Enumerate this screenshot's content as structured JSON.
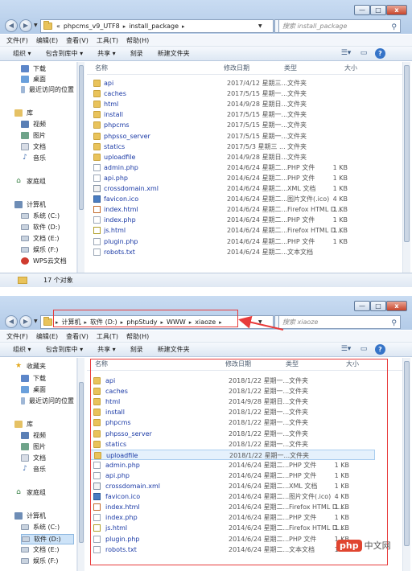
{
  "window_buttons": {
    "minimize": "—",
    "maximize": "□",
    "close": "x"
  },
  "icons": {
    "back": "back-icon",
    "forward": "forward-icon",
    "refresh": "refresh-icon",
    "search": "search-icon",
    "help": "help-icon"
  },
  "colors": {
    "folder": "#e9c35b",
    "selection": "#cde3f8",
    "link_text": "#1b3aa6",
    "annotation_red": "#e83b3b",
    "watermark_red": "#e04530"
  },
  "menu": [
    "文件(F)",
    "编辑(E)",
    "查看(V)",
    "工具(T)",
    "帮助(H)"
  ],
  "toolbar": {
    "organize": "组织 ▾",
    "include": "包含到库中 ▾",
    "share": "共享 ▾",
    "burn": "刻录",
    "new_folder": "新建文件夹"
  },
  "columns": {
    "name": "名称",
    "date": "修改日期",
    "type": "类型",
    "size": "大小"
  },
  "window1": {
    "breadcrumb": [
      "«",
      "phpcms_v9_UTF8",
      "install_package"
    ],
    "search_placeholder": "搜索 install_package",
    "nav": [
      {
        "label": "下载",
        "icon": "dl"
      },
      {
        "label": "桌面",
        "icon": "desk"
      },
      {
        "label": "最近访问的位置",
        "icon": "recent"
      },
      {
        "label": "库",
        "icon": "lib"
      },
      {
        "label": "视频",
        "icon": "vid"
      },
      {
        "label": "图片",
        "icon": "pic"
      },
      {
        "label": "文档",
        "icon": "doc"
      },
      {
        "label": "音乐",
        "icon": "music"
      },
      {
        "label": "家庭组",
        "icon": "home"
      },
      {
        "label": "计算机",
        "icon": "pc"
      },
      {
        "label": "系统 (C:)",
        "icon": "drv"
      },
      {
        "label": "软件 (D:)",
        "icon": "drv"
      },
      {
        "label": "文档 (E:)",
        "icon": "drv"
      },
      {
        "label": "娱乐 (F:)",
        "icon": "drv"
      },
      {
        "label": "WPS云文档",
        "icon": "wps"
      }
    ],
    "files": [
      {
        "name": "api",
        "date": "2017/4/12 星期三...",
        "type": "文件夹",
        "size": "",
        "icon": "folder"
      },
      {
        "name": "caches",
        "date": "2017/5/15 星期一...",
        "type": "文件夹",
        "size": "",
        "icon": "folder"
      },
      {
        "name": "html",
        "date": "2014/9/28 星期日...",
        "type": "文件夹",
        "size": "",
        "icon": "folder"
      },
      {
        "name": "install",
        "date": "2017/5/15 星期一...",
        "type": "文件夹",
        "size": "",
        "icon": "folder"
      },
      {
        "name": "phpcms",
        "date": "2017/5/15 星期一...",
        "type": "文件夹",
        "size": "",
        "icon": "folder"
      },
      {
        "name": "phpsso_server",
        "date": "2017/5/15 星期一...",
        "type": "文件夹",
        "size": "",
        "icon": "folder"
      },
      {
        "name": "statics",
        "date": "2017/5/3 星期三 ...",
        "type": "文件夹",
        "size": "",
        "icon": "folder"
      },
      {
        "name": "uploadfile",
        "date": "2014/9/28 星期日...",
        "type": "文件夹",
        "size": "",
        "icon": "folder"
      },
      {
        "name": "admin.php",
        "date": "2014/6/24 星期二...",
        "type": "PHP 文件",
        "size": "1 KB",
        "icon": "php"
      },
      {
        "name": "api.php",
        "date": "2014/6/24 星期二...",
        "type": "PHP 文件",
        "size": "1 KB",
        "icon": "php"
      },
      {
        "name": "crossdomain.xml",
        "date": "2014/6/24 星期二...",
        "type": "XML 文档",
        "size": "1 KB",
        "icon": "xml"
      },
      {
        "name": "favicon.ico",
        "date": "2014/6/24 星期二...",
        "type": "图片文件(.ico)",
        "size": "4 KB",
        "icon": "ico"
      },
      {
        "name": "index.html",
        "date": "2014/6/24 星期二...",
        "type": "Firefox HTML D...",
        "size": "1 KB",
        "icon": "htm"
      },
      {
        "name": "index.php",
        "date": "2014/6/24 星期二...",
        "type": "PHP 文件",
        "size": "1 KB",
        "icon": "php"
      },
      {
        "name": "js.html",
        "date": "2014/6/24 星期二...",
        "type": "Firefox HTML D...",
        "size": "1 KB",
        "icon": "js"
      },
      {
        "name": "plugin.php",
        "date": "2014/6/24 星期二...",
        "type": "PHP 文件",
        "size": "1 KB",
        "icon": "php"
      },
      {
        "name": "robots.txt",
        "date": "2014/6/24 星期二...",
        "type": "文本文档",
        "size": "",
        "icon": "txt"
      }
    ],
    "status": "17 个对象"
  },
  "window2": {
    "breadcrumb": [
      "计算机",
      "软件 (D:)",
      "phpStudy",
      "WWW",
      "xiaoze"
    ],
    "search_placeholder": "搜索 xiaoze",
    "nav": [
      {
        "label": "收藏夹",
        "icon": "star"
      },
      {
        "label": "下载",
        "icon": "dl"
      },
      {
        "label": "桌面",
        "icon": "desk"
      },
      {
        "label": "最近访问的位置",
        "icon": "recent"
      },
      {
        "label": "库",
        "icon": "lib"
      },
      {
        "label": "视频",
        "icon": "vid"
      },
      {
        "label": "图片",
        "icon": "pic"
      },
      {
        "label": "文档",
        "icon": "doc"
      },
      {
        "label": "音乐",
        "icon": "music"
      },
      {
        "label": "家庭组",
        "icon": "home"
      },
      {
        "label": "计算机",
        "icon": "pc"
      },
      {
        "label": "系统 (C:)",
        "icon": "drv"
      },
      {
        "label": "软件 (D:)",
        "icon": "drv"
      },
      {
        "label": "文档 (E:)",
        "icon": "drv"
      },
      {
        "label": "娱乐 (F:)",
        "icon": "drv"
      }
    ],
    "files": [
      {
        "name": "api",
        "date": "2018/1/22 星期一...",
        "type": "文件夹",
        "size": "",
        "icon": "folder"
      },
      {
        "name": "caches",
        "date": "2018/1/22 星期一...",
        "type": "文件夹",
        "size": "",
        "icon": "folder"
      },
      {
        "name": "html",
        "date": "2014/9/28 星期日...",
        "type": "文件夹",
        "size": "",
        "icon": "folder"
      },
      {
        "name": "install",
        "date": "2018/1/22 星期一...",
        "type": "文件夹",
        "size": "",
        "icon": "folder"
      },
      {
        "name": "phpcms",
        "date": "2018/1/22 星期一...",
        "type": "文件夹",
        "size": "",
        "icon": "folder"
      },
      {
        "name": "phpsso_server",
        "date": "2018/1/22 星期一...",
        "type": "文件夹",
        "size": "",
        "icon": "folder"
      },
      {
        "name": "statics",
        "date": "2018/1/22 星期一...",
        "type": "文件夹",
        "size": "",
        "icon": "folder"
      },
      {
        "name": "uploadfile",
        "date": "2018/1/22 星期一...",
        "type": "文件夹",
        "size": "",
        "icon": "folder"
      },
      {
        "name": "admin.php",
        "date": "2014/6/24 星期二...",
        "type": "PHP 文件",
        "size": "1 KB",
        "icon": "php"
      },
      {
        "name": "api.php",
        "date": "2014/6/24 星期二...",
        "type": "PHP 文件",
        "size": "1 KB",
        "icon": "php"
      },
      {
        "name": "crossdomain.xml",
        "date": "2014/6/24 星期二...",
        "type": "XML 文档",
        "size": "1 KB",
        "icon": "xml"
      },
      {
        "name": "favicon.ico",
        "date": "2014/6/24 星期二...",
        "type": "图片文件(.ico)",
        "size": "4 KB",
        "icon": "ico"
      },
      {
        "name": "index.html",
        "date": "2014/6/24 星期二...",
        "type": "Firefox HTML D...",
        "size": "1 KB",
        "icon": "htm"
      },
      {
        "name": "index.php",
        "date": "2014/6/24 星期二...",
        "type": "PHP 文件",
        "size": "1 KB",
        "icon": "php"
      },
      {
        "name": "js.html",
        "date": "2014/6/24 星期二...",
        "type": "Firefox HTML D...",
        "size": "1 KB",
        "icon": "js"
      },
      {
        "name": "plugin.php",
        "date": "2014/6/24 星期二...",
        "type": "PHP 文件",
        "size": "1 KB",
        "icon": "php"
      },
      {
        "name": "robots.txt",
        "date": "2014/6/24 星期二...",
        "type": "文本文档",
        "size": "1 KB",
        "icon": "txt"
      }
    ]
  },
  "watermark": {
    "logo": "php",
    "text": "中文网"
  }
}
